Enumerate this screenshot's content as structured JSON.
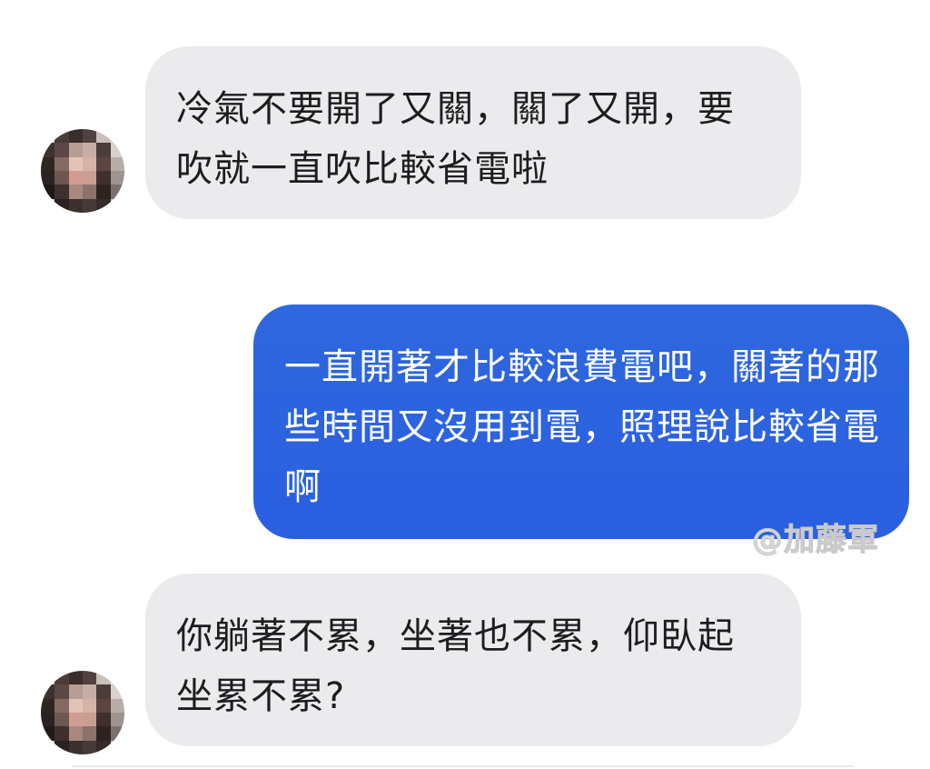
{
  "conversation": {
    "messages": [
      {
        "sender": "other",
        "text": "冷氣不要開了又關，關了又開，要吹就一直吹比較省電啦"
      },
      {
        "sender": "self",
        "text": "一直開著才比較浪費電吧，關著的那些時間又沒用到電，照理說比較省電啊"
      },
      {
        "sender": "other",
        "text": "你躺著不累，坐著也不累，仰臥起坐累不累?"
      }
    ],
    "watermark": "@加藤軍"
  },
  "colors": {
    "incoming_bubble": "#ebebed",
    "outgoing_bubble": "#2a62df",
    "background": "#ffffff",
    "watermark": "#d8d8d8"
  },
  "icons": {
    "avatar": "pixelated-avatar-icon"
  }
}
